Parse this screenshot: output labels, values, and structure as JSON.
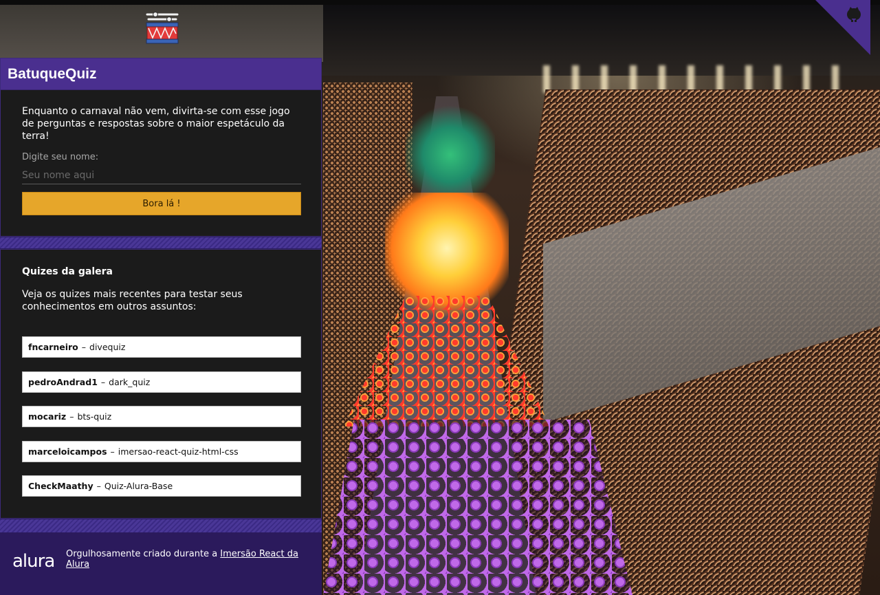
{
  "app": {
    "title": "BatuqueQuiz"
  },
  "intro": {
    "text": "Enquanto o carnaval não vem, divirta-se com esse jogo de perguntas e respostas sobre o maior espetáculo da terra!",
    "name_label": "Digite seu nome:",
    "name_placeholder": "Seu nome aqui",
    "name_value": "",
    "play_button": "Bora lá !"
  },
  "community": {
    "title": "Quizes da galera",
    "text": "Veja os quizes mais recentes para testar seus conhecimentos em outros assuntos:",
    "separator": "–",
    "quizzes": [
      {
        "user": "fncarneiro",
        "project": "divequiz"
      },
      {
        "user": "pedroAndrad1",
        "project": "dark_quiz"
      },
      {
        "user": "mocariz",
        "project": "bts-quiz"
      },
      {
        "user": "marceloicampos",
        "project": "imersao-react-quiz-html-css"
      },
      {
        "user": "CheckMaathy",
        "project": "Quiz-Alura-Base"
      }
    ]
  },
  "footer": {
    "logo": "alura",
    "text_prefix": "Orgulhosamente criado durante a ",
    "link_text": "Imersão React da Alura"
  },
  "colors": {
    "primary": "#4a2f8f",
    "secondary": "#e6a62a",
    "card_bg": "#1b1b1b",
    "footer_bg": "#2b1a5c"
  },
  "icons": {
    "logo": "drum-icon",
    "corner": "github-icon"
  }
}
